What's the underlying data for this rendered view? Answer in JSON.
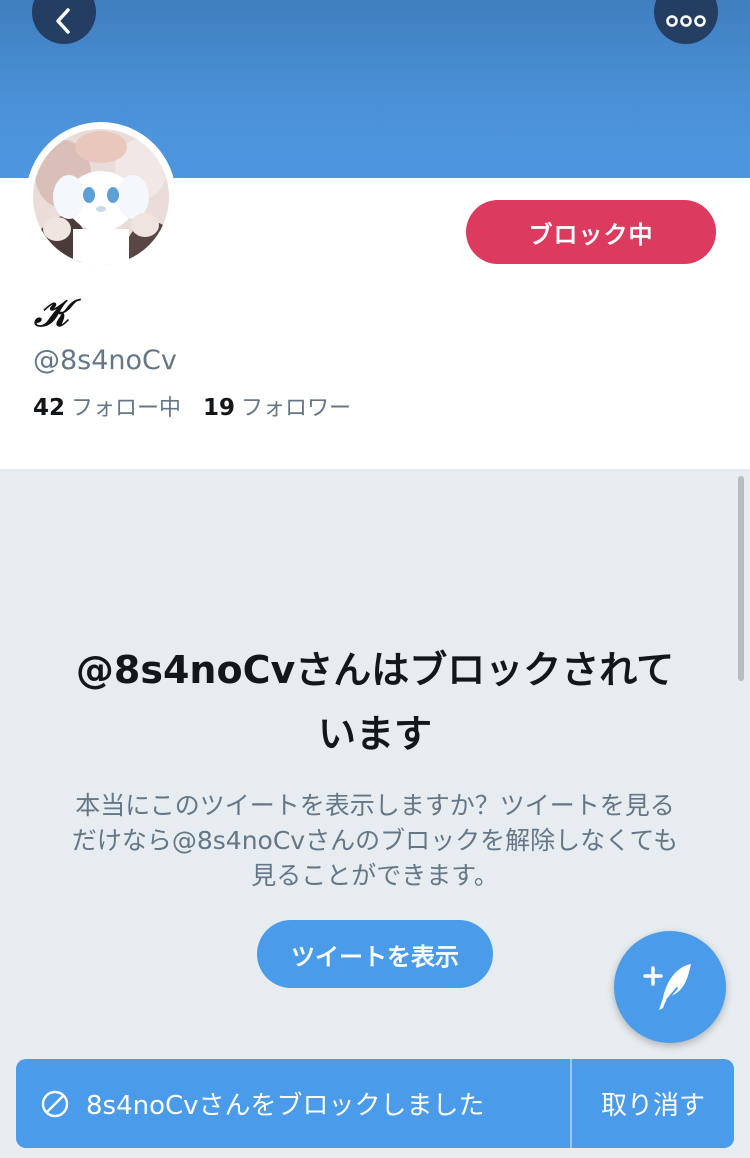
{
  "header": {
    "back_icon": "chevron-left-icon",
    "more_icon": "more-horizontal-icon",
    "banner_color": "#4a90d6"
  },
  "profile": {
    "display_name": "𝒦",
    "handle": "@8s4noCv",
    "block_button_label": "ブロック中",
    "following_count": "42",
    "following_label": "フォロー中",
    "followers_count": "19",
    "followers_label": "フォロワー"
  },
  "blocked_notice": {
    "title": "@8s4noCvさんはブロックされています",
    "description": "本当にこのツイートを表示しますか？ツイートを見るだけなら@8s4noCvさんのブロックを解除しなくても見ることができます。",
    "show_button_label": "ツイートを表示"
  },
  "compose": {
    "icon": "compose-tweet-icon"
  },
  "toast": {
    "icon": "block-icon",
    "message": "8s4noCvさんをブロックしました",
    "undo_label": "取り消す"
  },
  "colors": {
    "accent": "#4a9cea",
    "block": "#dc3a5e",
    "muted_text": "#657786"
  }
}
